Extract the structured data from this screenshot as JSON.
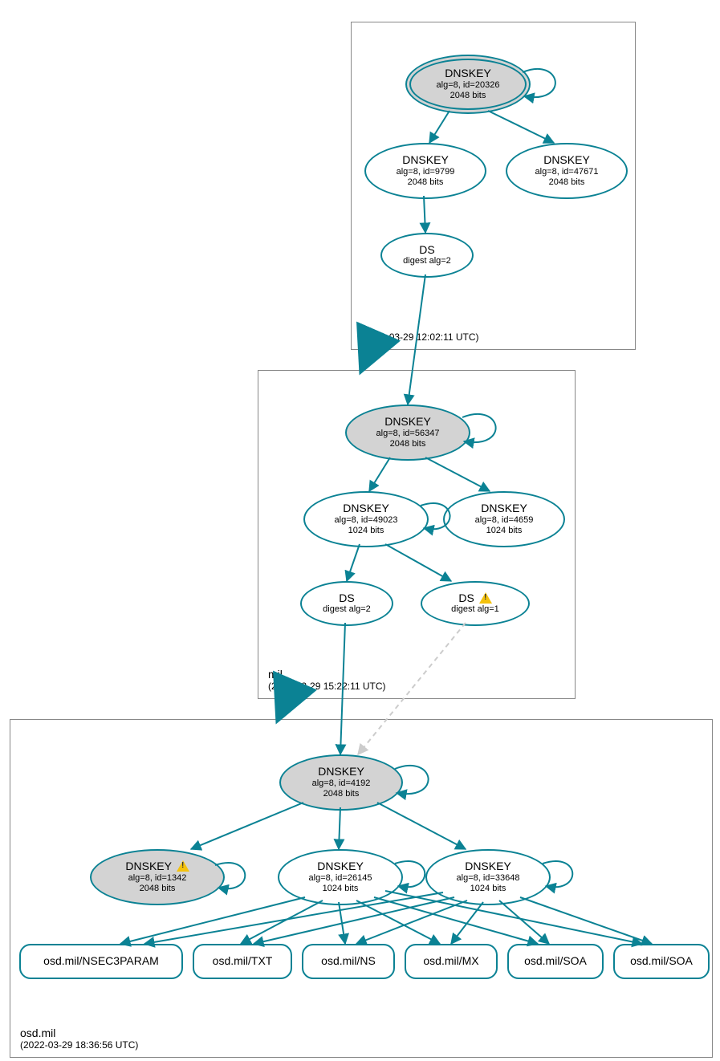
{
  "colors": {
    "stroke": "#0b8294",
    "ksk_fill": "#d3d3d3"
  },
  "zones": {
    "root": {
      "name": ".",
      "ts": "(2022-03-29 12:02:11 UTC)"
    },
    "mil": {
      "name": "mil",
      "ts": "(2022-03-29 15:22:11 UTC)"
    },
    "osd": {
      "name": "osd.mil",
      "ts": "(2022-03-29 18:36:56 UTC)"
    }
  },
  "nodes": {
    "root_ksk": {
      "title": "DNSKEY",
      "l1": "alg=8, id=20326",
      "l2": "2048 bits"
    },
    "root_zsk1": {
      "title": "DNSKEY",
      "l1": "alg=8, id=9799",
      "l2": "2048 bits"
    },
    "root_zsk2": {
      "title": "DNSKEY",
      "l1": "alg=8, id=47671",
      "l2": "2048 bits"
    },
    "root_ds": {
      "title": "DS",
      "l1": "digest alg=2"
    },
    "mil_ksk": {
      "title": "DNSKEY",
      "l1": "alg=8, id=56347",
      "l2": "2048 bits"
    },
    "mil_zsk1": {
      "title": "DNSKEY",
      "l1": "alg=8, id=49023",
      "l2": "1024 bits"
    },
    "mil_zsk2": {
      "title": "DNSKEY",
      "l1": "alg=8, id=4659",
      "l2": "1024 bits"
    },
    "mil_ds1": {
      "title": "DS",
      "l1": "digest alg=2"
    },
    "mil_ds2": {
      "title": "DS",
      "l1": "digest alg=1"
    },
    "osd_ksk": {
      "title": "DNSKEY",
      "l1": "alg=8, id=4192",
      "l2": "2048 bits"
    },
    "osd_k1342": {
      "title": "DNSKEY",
      "l1": "alg=8, id=1342",
      "l2": "2048 bits"
    },
    "osd_z26145": {
      "title": "DNSKEY",
      "l1": "alg=8, id=26145",
      "l2": "1024 bits"
    },
    "osd_z33648": {
      "title": "DNSKEY",
      "l1": "alg=8, id=33648",
      "l2": "1024 bits"
    }
  },
  "rrsets": {
    "r1": "osd.mil/NSEC3PARAM",
    "r2": "osd.mil/TXT",
    "r3": "osd.mil/NS",
    "r4": "osd.mil/MX",
    "r5": "osd.mil/SOA",
    "r6": "osd.mil/SOA"
  }
}
